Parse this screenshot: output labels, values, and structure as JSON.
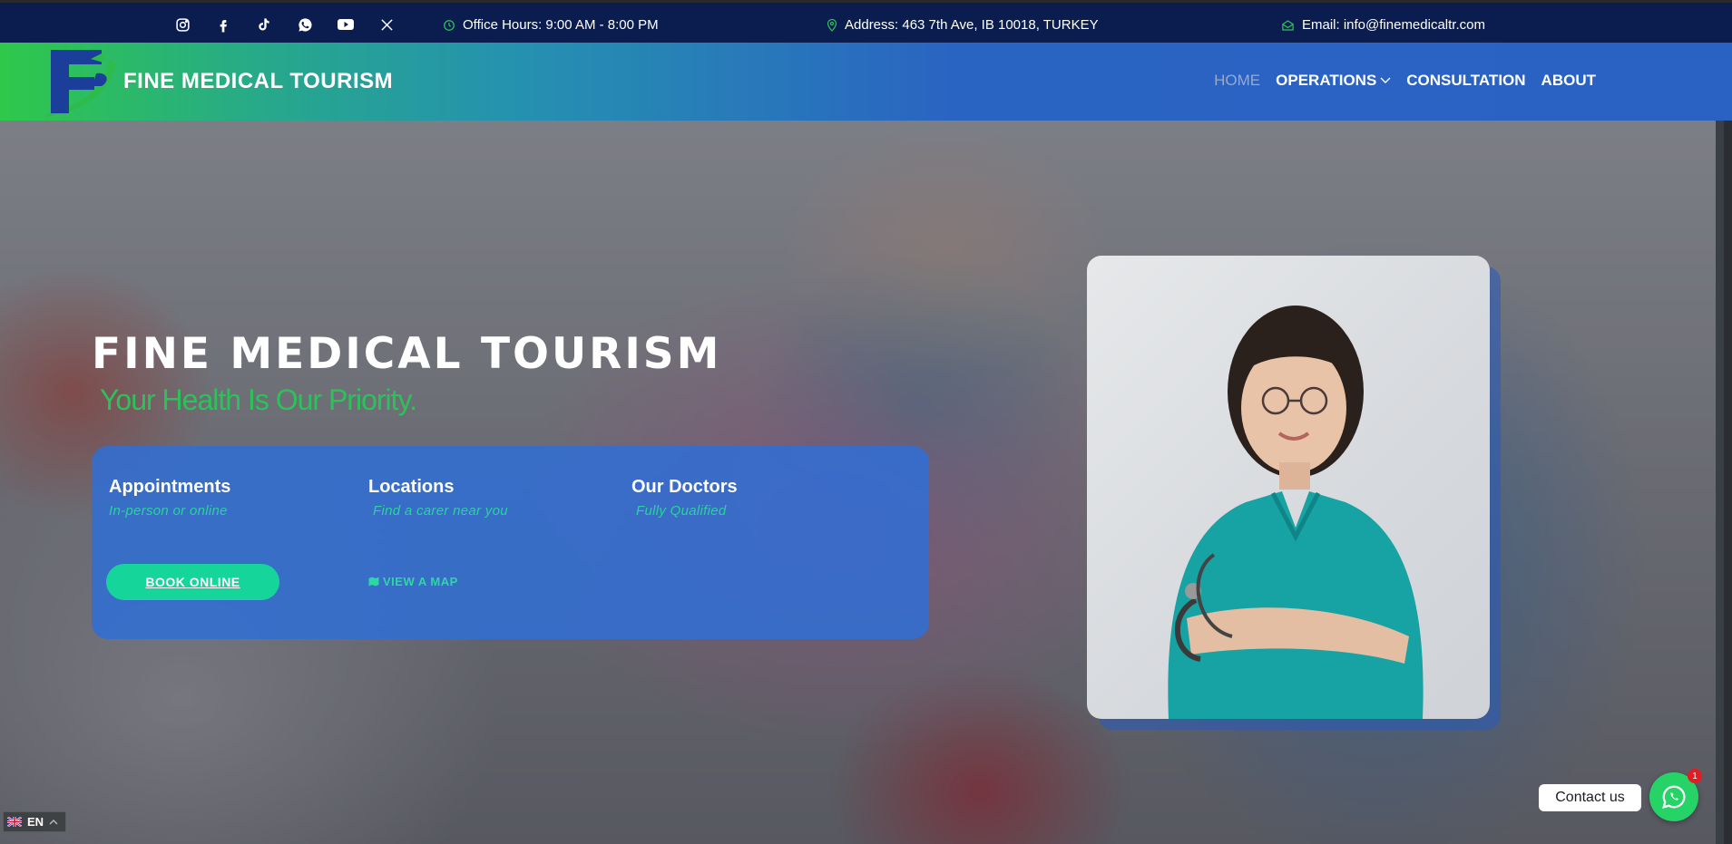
{
  "topbar": {
    "social_icons": [
      "instagram-icon",
      "facebook-icon",
      "tiktok-icon",
      "whatsapp-icon",
      "youtube-icon",
      "x-icon"
    ],
    "office_hours": "Office Hours: 9:00 AM - 8:00 PM",
    "address": "Address: 463 7th Ave, IB 10018, TURKEY",
    "email": "Email: info@finemedicaltr.com"
  },
  "header": {
    "brand": "FINE MEDICAL TOURISM",
    "nav": {
      "home": "HOME",
      "operations": "OPERATIONS",
      "consultation": "CONSULTATION",
      "about": "ABOUT"
    }
  },
  "hero": {
    "title": "FINE MEDICAL TOURISM",
    "subtitle": "Your Health Is Our Priority.",
    "card": {
      "appointments_title": "Appointments",
      "appointments_sub": "In-person or online",
      "locations_title": "Locations",
      "locations_sub": "Find a carer near you",
      "doctors_title": "Our Doctors",
      "doctors_sub": "Fully Qualified",
      "book_label": "BOOK ONLINE",
      "map_label": "VIEW A MAP"
    }
  },
  "lang": {
    "code": "EN"
  },
  "contact": {
    "label": "Contact us",
    "badge": "1"
  },
  "colors": {
    "topbar": "#0b1d4f",
    "accent_green": "#2cc25a",
    "button_green": "#15d59a",
    "card_blue": "#306ed6"
  }
}
